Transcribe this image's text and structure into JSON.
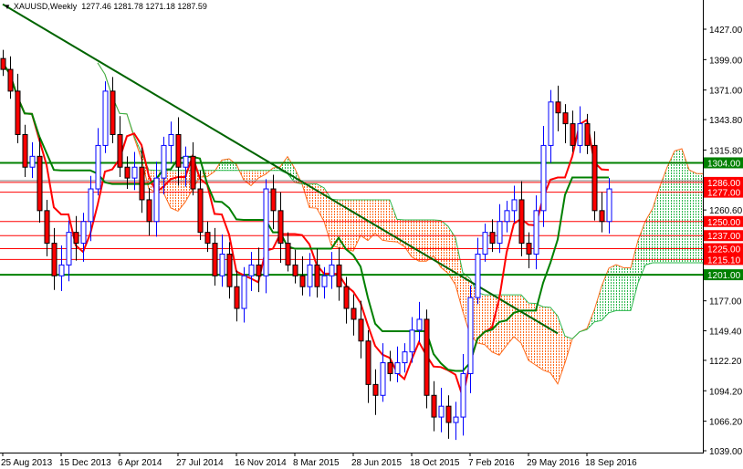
{
  "header": {
    "symbol": "XAUUSD,Weekly",
    "ohlc": "1277.46 1281.78 1271.18 1287.59",
    "menu_arrow_icon": "triangle-down-icon"
  },
  "colors": {
    "bull": "#0000ff",
    "bear": "#ff0000",
    "tenkan": "#ff0000",
    "kijun": "#008000",
    "cloud_bear": "#ff6a1a",
    "cloud_bull": "#2db84d",
    "trendline": "#006400",
    "price_line": "#808080"
  },
  "chart_data": {
    "type": "candlestick",
    "title": "XAUUSD,Weekly",
    "ylim": [
      1039,
      1427
    ],
    "y_ticks": [
      "1427.00",
      "1399.00",
      "1371.00",
      "1343.80",
      "1315.80",
      "1260.60",
      "1177.00",
      "1149.40",
      "1122.20",
      "1094.20",
      "1066.20",
      "1039.00"
    ],
    "y_tick_values": [
      1427,
      1399,
      1371,
      1343.8,
      1315.8,
      1260.6,
      1177,
      1149.4,
      1122.2,
      1094.2,
      1066.2,
      1039
    ],
    "x_ticks": [
      "25 Aug 2013",
      "15 Dec 2013",
      "6 Apr 2014",
      "27 Jul 2014",
      "16 Nov 2014",
      "8 Mar 2015",
      "28 Jun 2015",
      "18 Oct 2015",
      "7 Feb 2016",
      "29 May 2016",
      "18 Sep 2016"
    ],
    "x_tick_bars": [
      0,
      8,
      16,
      24,
      32,
      40,
      48,
      56,
      64,
      72,
      80
    ],
    "bar_period_weeks": 2,
    "closes": [
      1390,
      1370,
      1330,
      1300,
      1310,
      1260,
      1230,
      1200,
      1210,
      1240,
      1230,
      1250,
      1280,
      1320,
      1370,
      1330,
      1300,
      1290,
      1300,
      1270,
      1250,
      1290,
      1320,
      1330,
      1300,
      1310,
      1280,
      1240,
      1230,
      1200,
      1220,
      1190,
      1170,
      1200,
      1210,
      1200,
      1280,
      1260,
      1230,
      1210,
      1200,
      1190,
      1210,
      1190,
      1200,
      1210,
      1190,
      1170,
      1160,
      1140,
      1100,
      1090,
      1120,
      1110,
      1120,
      1130,
      1150,
      1160,
      1090,
      1070,
      1080,
      1065,
      1070,
      1110,
      1180,
      1220,
      1240,
      1230,
      1250,
      1260,
      1270,
      1230,
      1220,
      1260,
      1320,
      1360,
      1350,
      1340,
      1320,
      1340,
      1320,
      1260,
      1250,
      1280
    ],
    "indicators": [
      "Ichimoku Tenkan-sen",
      "Ichimoku Kijun-sen",
      "Ichimoku Cloud"
    ],
    "levels": [
      {
        "price": 1304.0,
        "label": "1304.00",
        "kind": "support-green"
      },
      {
        "price": 1286.0,
        "label": "1286.00",
        "kind": "red"
      },
      {
        "price": 1277.0,
        "label": "1277.00",
        "kind": "red"
      },
      {
        "price": 1250.0,
        "label": "1250.00",
        "kind": "red"
      },
      {
        "price": 1237.0,
        "label": "1237.00",
        "kind": "red"
      },
      {
        "price": 1225.0,
        "label": "1225.00",
        "kind": "red"
      },
      {
        "price": 1215.1,
        "label": "1215.10",
        "kind": "red"
      },
      {
        "price": 1201.0,
        "label": "1201.00",
        "kind": "support-green"
      }
    ],
    "current_price": 1287.59,
    "trendline": {
      "from": {
        "bar": 0,
        "price": 1450
      },
      "to": {
        "bar": 76,
        "price": 1147
      }
    }
  }
}
